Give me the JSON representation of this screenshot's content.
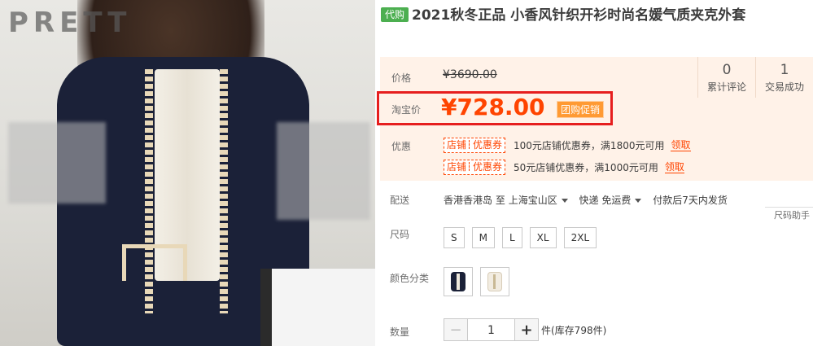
{
  "product": {
    "tag": "代购",
    "title": "2021秋冬正品  小香风针织开衫时尚名媛气质夹克外套"
  },
  "price": {
    "label": "价格",
    "original": "¥3690.00",
    "taobao_label": "淘宝价",
    "current": "¥728.00",
    "promo_badge": "团购促销"
  },
  "stats": [
    {
      "count": "0",
      "label": "累计评论"
    },
    {
      "count": "1",
      "label": "交易成功"
    }
  ],
  "coupons": {
    "label": "优惠",
    "tag_left": "店铺",
    "tag_right": "优惠券",
    "items": [
      {
        "text": "100元店铺优惠券，满1800元可用",
        "action": "领取"
      },
      {
        "text": "50元店铺优惠券，满1000元可用",
        "action": "领取"
      }
    ]
  },
  "shipping": {
    "label": "配送",
    "from": "香港香港岛",
    "to_word": "至",
    "to": "上海宝山区",
    "method": "快递 免运费",
    "dispatch": "付款后7天内发货"
  },
  "size": {
    "label": "尺码",
    "help": "尺码助手",
    "options": [
      "S",
      "M",
      "L",
      "XL",
      "2XL"
    ]
  },
  "color": {
    "label": "颜色分类",
    "options": [
      "navy-jacket-swatch",
      "cream-jacket-swatch"
    ]
  },
  "quantity": {
    "label": "数量",
    "value": "1",
    "minus": "−",
    "plus": "+",
    "stock": "件(库存798件)"
  },
  "photo": {
    "watermark": "PRETT"
  },
  "colors": {
    "accent": "#ff4400",
    "highlight_box": "#e61e1e",
    "price_panel_bg": "#fff2e8",
    "tag_green": "#4caf50"
  }
}
